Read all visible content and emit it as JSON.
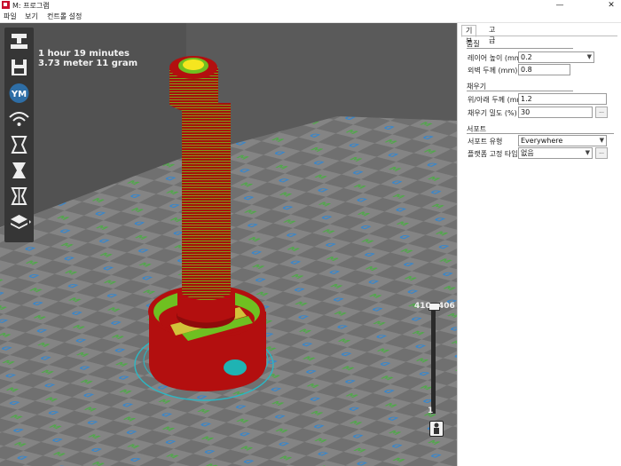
{
  "window": {
    "title": "M: 프로그램",
    "minimize": "—",
    "close": "✕"
  },
  "menu": {
    "items": [
      "파일",
      "보기",
      "컨트롤 설정"
    ]
  },
  "toolbar": {
    "tools": [
      "printer-icon",
      "save-icon",
      "ym-logo",
      "wifi-icon",
      "slice-icon",
      "print-mode-icon",
      "support-icon",
      "layers-icon"
    ],
    "logo_text": "YM"
  },
  "estimate": {
    "time": "1 hour 19 minutes",
    "material": "3.73 meter 11 gram"
  },
  "layer_slider": {
    "top_max": "410",
    "top_current": "406",
    "bottom": "1"
  },
  "panel": {
    "tabs": [
      "기본",
      "고급"
    ],
    "active_tab": 0,
    "quality": {
      "title": "품질",
      "layer_height_label": "레이어 높이 (mm)",
      "layer_height_value": "0.2",
      "shell_thickness_label": "외벽 두께 (mm)",
      "shell_thickness_value": "0.8"
    },
    "fill": {
      "title": "채우기",
      "top_bottom_label": "위/아래 두께 (mm)",
      "top_bottom_value": "1.2",
      "fill_density_label": "채우기 밀도 (%)",
      "fill_density_value": "30",
      "more_button": "..."
    },
    "support": {
      "title": "서포트",
      "support_type_label": "서포트 유형",
      "support_type_value": "Everywhere",
      "platform_label": "플랫폼 고정 타입",
      "platform_value": "없음",
      "more_button": "..."
    }
  },
  "colors": {
    "viewport_bg": "#5c5c5c",
    "model_red": "#b30f0f",
    "model_green": "#6fc021",
    "model_yellow": "#f5e61f",
    "toolbar_bg": "#363636",
    "brand_blue": "#2e6ea6"
  }
}
